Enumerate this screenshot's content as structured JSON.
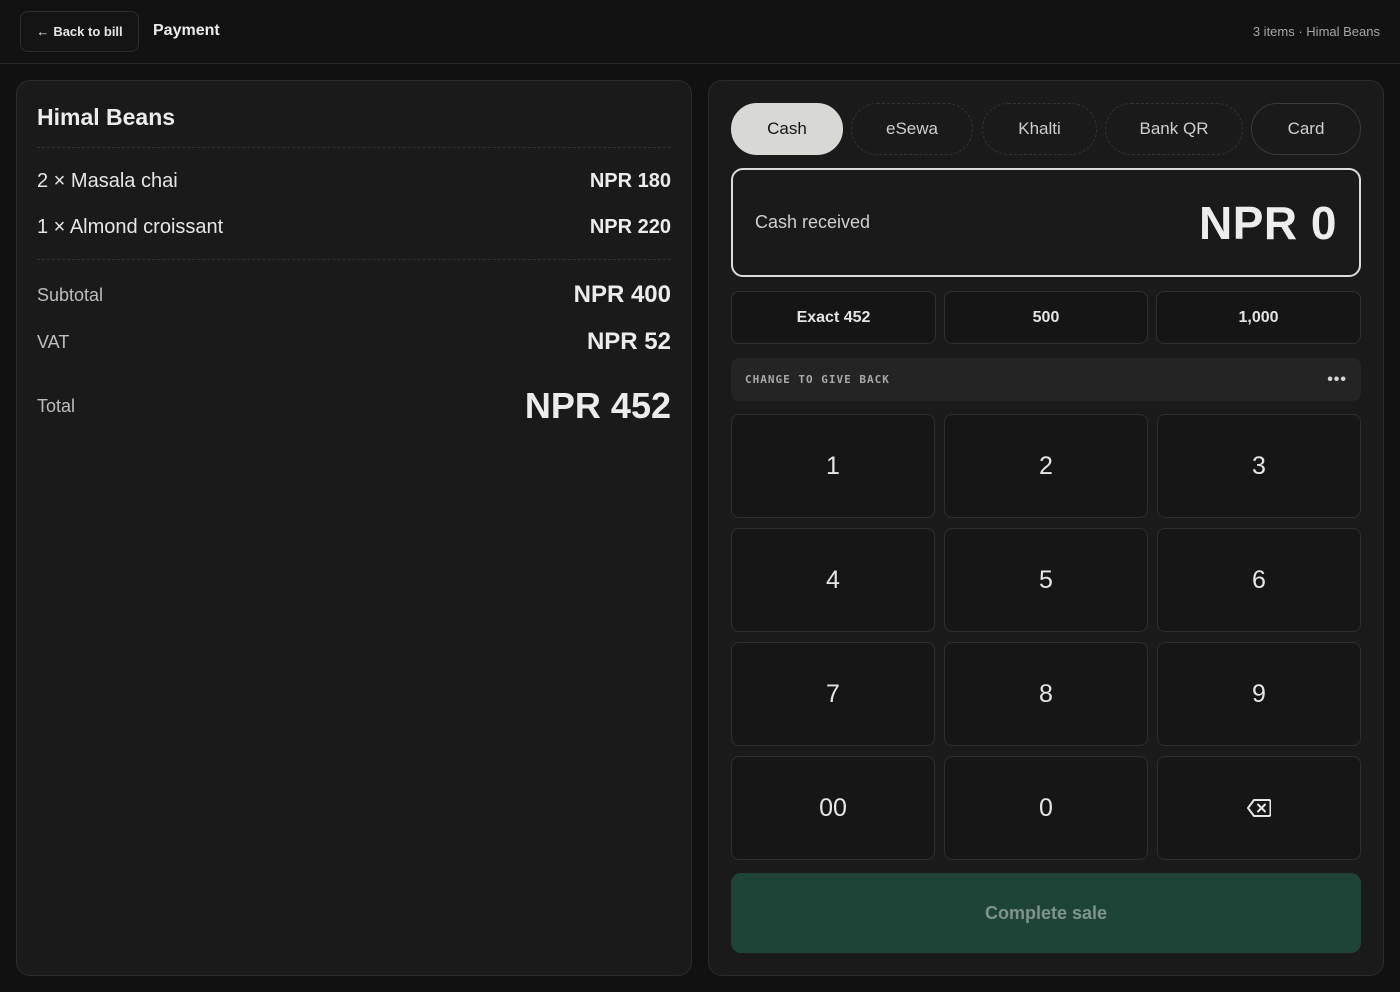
{
  "header": {
    "back_label": "Back to bill",
    "title": "Payment",
    "meta": "3 items · Himal Beans"
  },
  "bill": {
    "store_name": "Himal Beans",
    "items": [
      {
        "label": "2 × Masala chai",
        "price": "NPR 180"
      },
      {
        "label": "1 × Almond croissant",
        "price": "NPR 220"
      }
    ],
    "subtotal_label": "Subtotal",
    "subtotal_value": "NPR 400",
    "vat_label": "VAT",
    "vat_value": "NPR 52",
    "total_label": "Total",
    "total_value": "NPR 452"
  },
  "payment": {
    "methods": [
      "Cash",
      "eSewa",
      "Khalti",
      "Bank QR",
      "Card"
    ],
    "active_method": "Cash",
    "cash_label": "Cash received",
    "cash_value": "NPR 0",
    "quick_amounts": [
      "Exact 452",
      "500",
      "1,000"
    ],
    "change_label": "CHANGE TO GIVE BACK",
    "change_value": "•••",
    "keys": [
      "1",
      "2",
      "3",
      "4",
      "5",
      "6",
      "7",
      "8",
      "9",
      "00",
      "0"
    ],
    "complete_label": "Complete sale"
  },
  "colors": {
    "background": "#111111",
    "panel": "#1a1a1a",
    "accent_button": "#1e4437",
    "active_tab": "#d8d8d4"
  }
}
